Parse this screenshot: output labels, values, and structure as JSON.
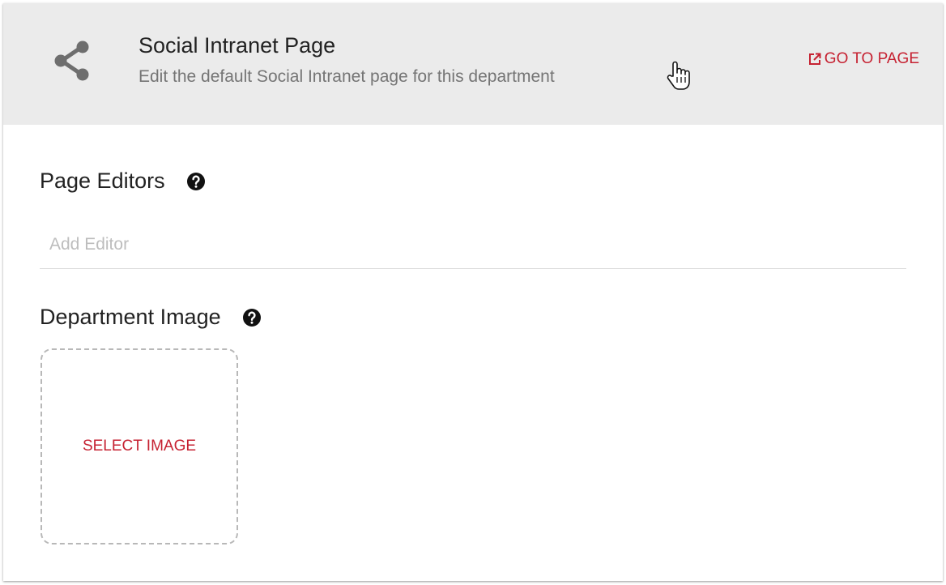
{
  "header": {
    "icon": "share-icon",
    "title": "Social Intranet Page",
    "subtitle": "Edit the default Social Intranet page for this department",
    "go_to_page_label": "GO TO PAGE",
    "go_to_page_icon": "open-in-new-icon"
  },
  "page_editors": {
    "title": "Page Editors",
    "help_icon": "help-circle-icon",
    "input_value": "",
    "input_placeholder": "Add Editor"
  },
  "department_image": {
    "title": "Department Image",
    "help_icon": "help-circle-icon",
    "select_label": "SELECT IMAGE"
  },
  "colors": {
    "accent": "#c62232",
    "header_bg": "#ebebeb",
    "title_text": "#222222",
    "subtitle_text": "#757575",
    "icon_gray": "#6e6e6e"
  }
}
